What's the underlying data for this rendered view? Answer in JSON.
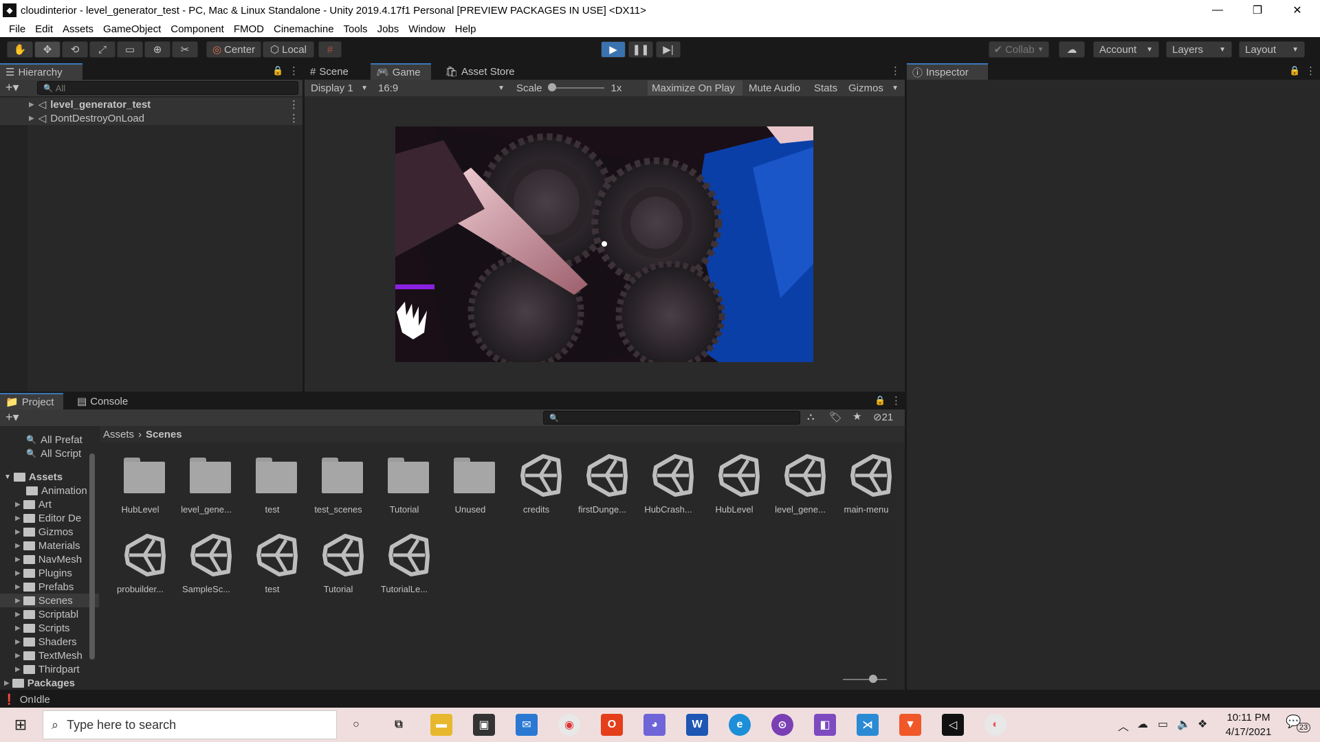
{
  "window": {
    "title": "cloudinterior - level_generator_test - PC, Mac & Linux Standalone - Unity 2019.4.17f1 Personal [PREVIEW PACKAGES IN USE] <DX11>"
  },
  "menu": [
    "File",
    "Edit",
    "Assets",
    "GameObject",
    "Component",
    "FMOD",
    "Cinemachine",
    "Tools",
    "Jobs",
    "Window",
    "Help"
  ],
  "toolbar": {
    "center": "Center",
    "local": "Local",
    "collab": "Collab",
    "account": "Account",
    "layers": "Layers",
    "layout": "Layout"
  },
  "hierarchy": {
    "title": "Hierarchy",
    "search_placeholder": "All",
    "items": [
      "level_generator_test",
      "DontDestroyOnLoad"
    ]
  },
  "game": {
    "tabs": [
      "Scene",
      "Game",
      "Asset Store"
    ],
    "display": "Display 1",
    "aspect": "16:9",
    "scale_label": "Scale",
    "scale_value": "1x",
    "maximize": "Maximize On Play",
    "mute": "Mute Audio",
    "stats": "Stats",
    "gizmos": "Gizmos"
  },
  "inspector": {
    "title": "Inspector"
  },
  "project": {
    "tabs": [
      "Project",
      "Console"
    ],
    "hidden_count": "21",
    "favorites": [
      "All Prefat",
      "All Script"
    ],
    "breadcrumb": [
      "Assets",
      "Scenes"
    ],
    "tree_root": "Assets",
    "tree": [
      "Animation",
      "Art",
      "Editor De",
      "Gizmos",
      "Materials",
      "NavMesh",
      "Plugins",
      "Prefabs",
      "Scenes",
      "Scriptabl",
      "Scripts",
      "Shaders",
      "TextMesh",
      "Thirdpart"
    ],
    "packages": "Packages",
    "assets_row1": [
      {
        "name": "HubLevel",
        "kind": "folder"
      },
      {
        "name": "level_gene...",
        "kind": "folder"
      },
      {
        "name": "test",
        "kind": "folder"
      },
      {
        "name": "test_scenes",
        "kind": "folder"
      },
      {
        "name": "Tutorial",
        "kind": "folder"
      },
      {
        "name": "Unused",
        "kind": "folder"
      },
      {
        "name": "credits",
        "kind": "scene"
      },
      {
        "name": "firstDunge...",
        "kind": "scene"
      },
      {
        "name": "HubCrash...",
        "kind": "scene"
      },
      {
        "name": "HubLevel",
        "kind": "scene"
      },
      {
        "name": "level_gene...",
        "kind": "scene"
      },
      {
        "name": "main-menu",
        "kind": "scene"
      }
    ],
    "assets_row2": [
      {
        "name": "probuilder...",
        "kind": "scene"
      },
      {
        "name": "SampleSc...",
        "kind": "scene"
      },
      {
        "name": "test",
        "kind": "scene"
      },
      {
        "name": "Tutorial",
        "kind": "scene"
      },
      {
        "name": "TutorialLe...",
        "kind": "scene"
      }
    ]
  },
  "status": {
    "text": "OnIdle"
  },
  "taskbar": {
    "search_placeholder": "Type here to search",
    "time": "10:11 PM",
    "date": "4/17/2021",
    "notifications": "23"
  }
}
